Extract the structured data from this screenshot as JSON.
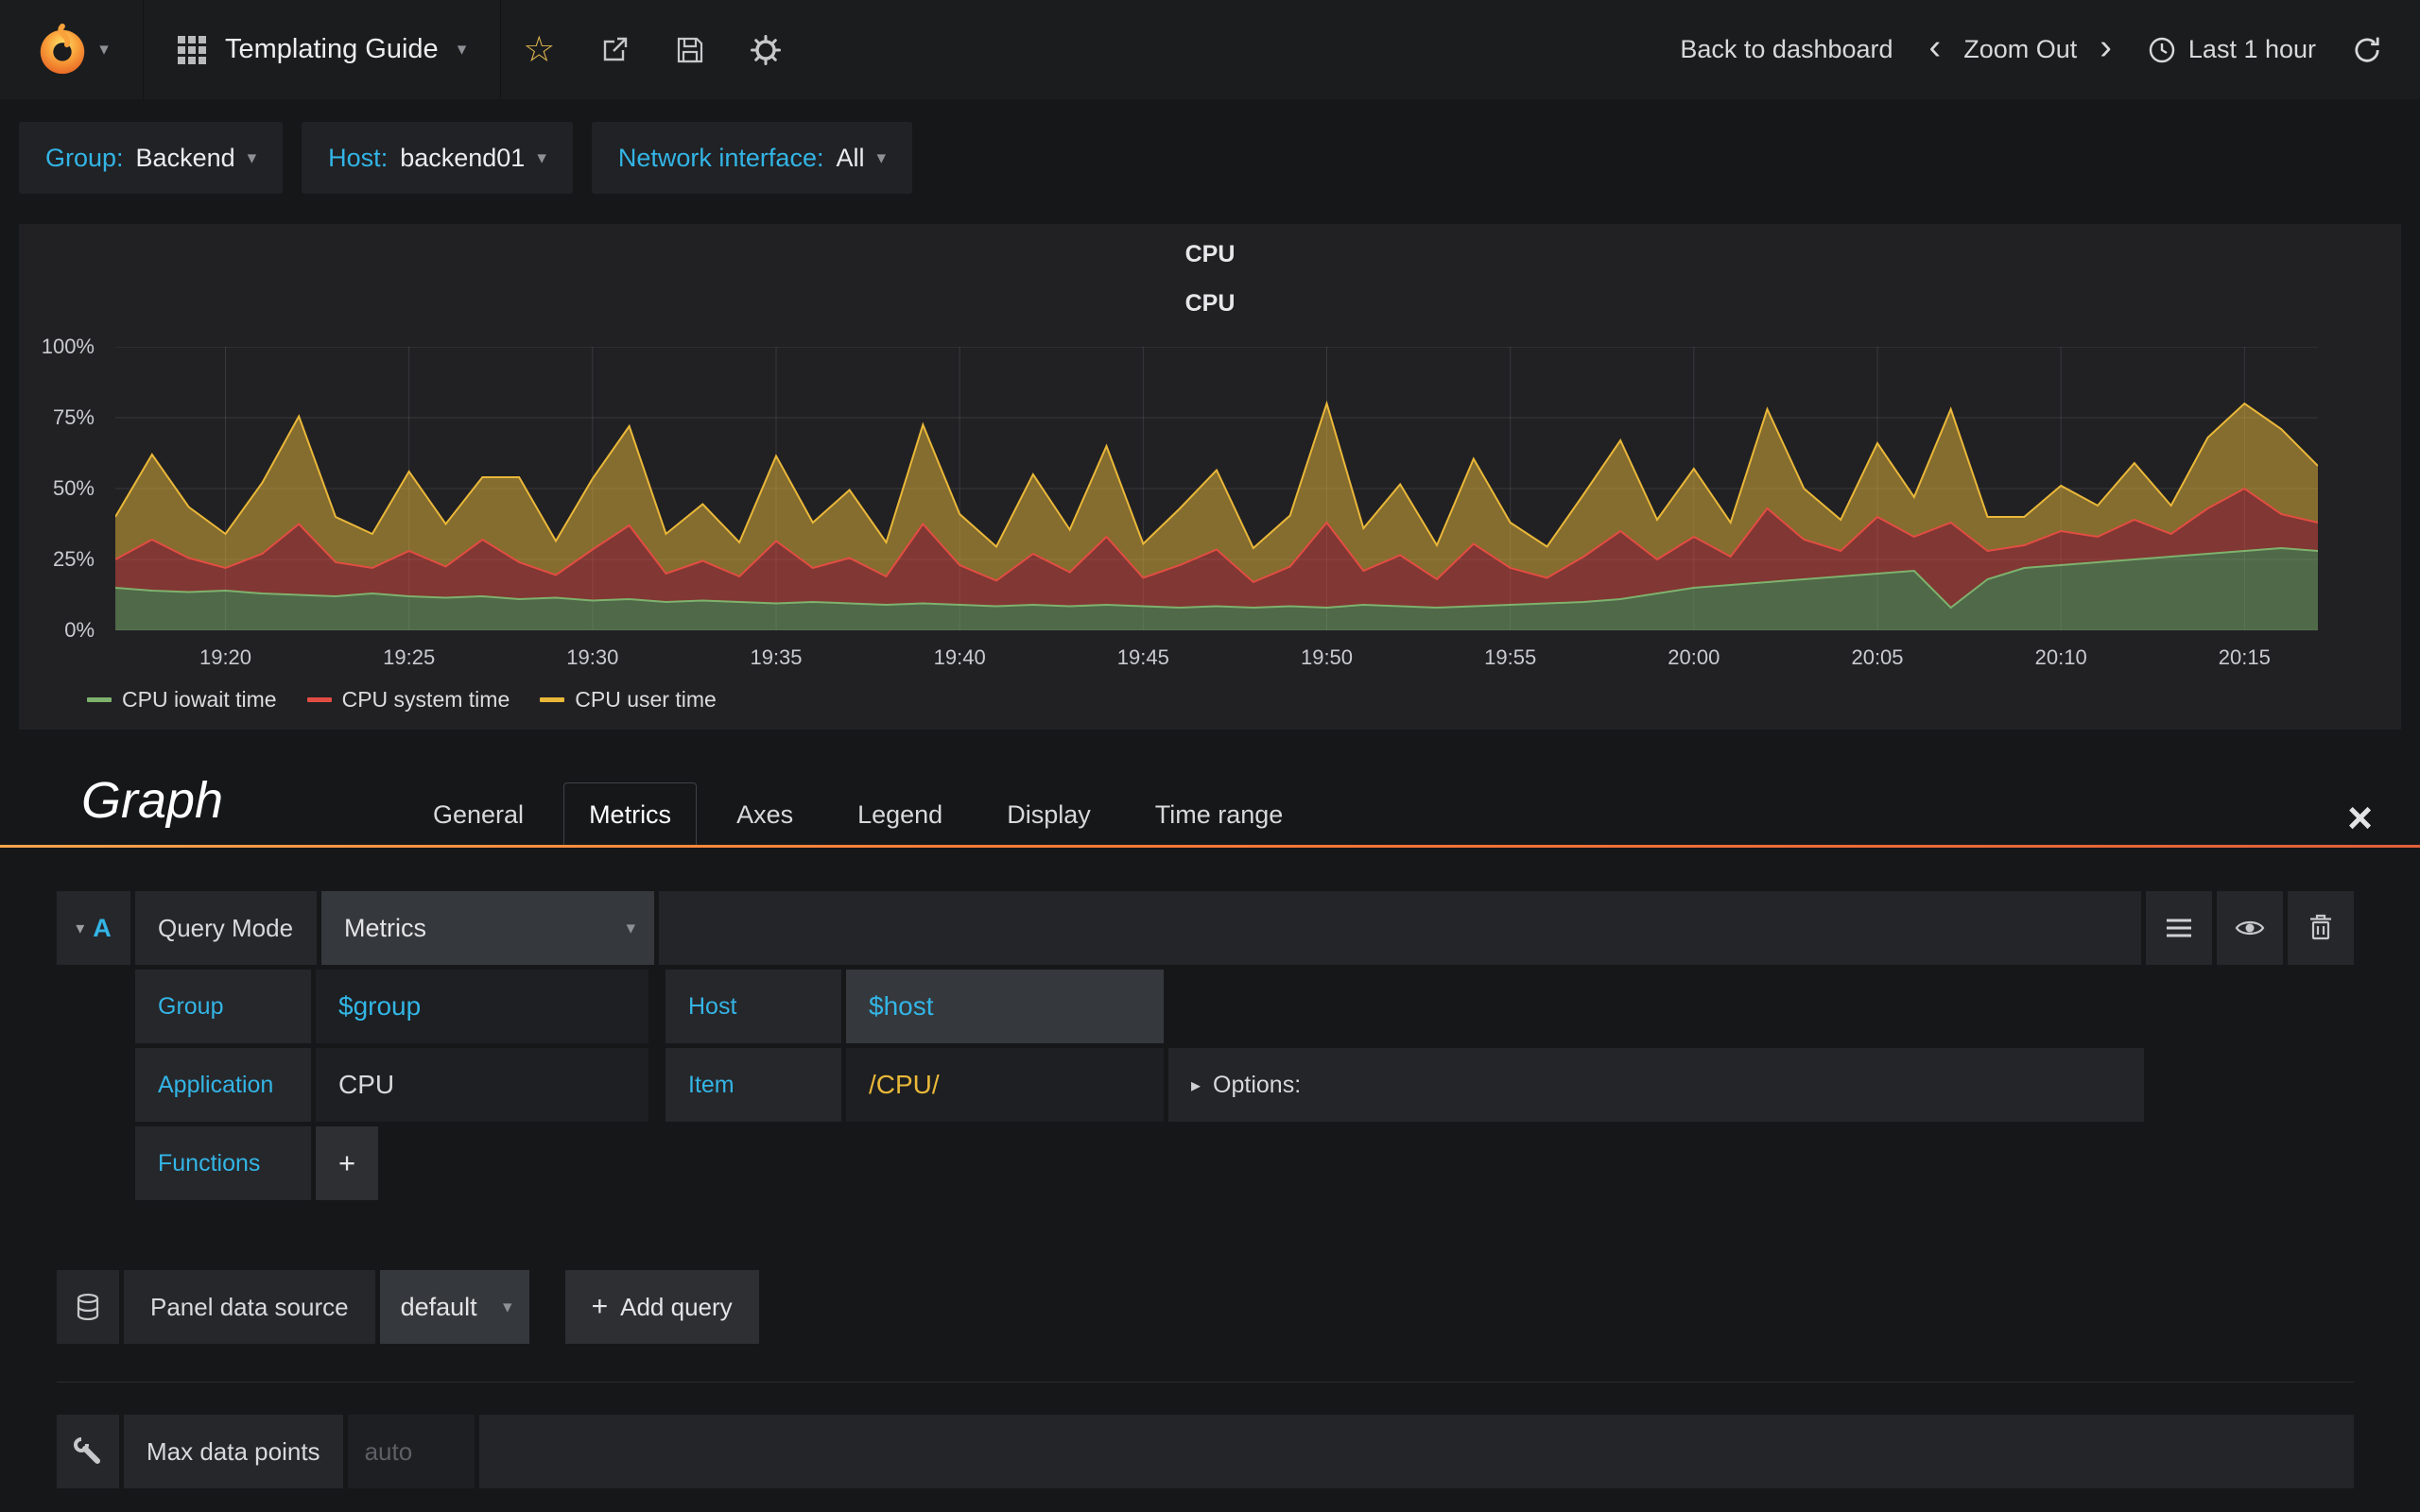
{
  "navbar": {
    "dashboard_title": "Templating Guide",
    "back_to_dashboard": "Back to dashboard",
    "zoom_out": "Zoom Out",
    "time_range": "Last 1 hour"
  },
  "icons": {
    "caret_down": "▾",
    "collapse_caret": "▾",
    "options_caret": "▸",
    "close": "×",
    "star": "☆",
    "plus": "+",
    "chevron_left": "‹",
    "chevron_right": "›"
  },
  "variables": [
    {
      "label": "Group:",
      "value": "Backend"
    },
    {
      "label": "Host:",
      "value": "backend01"
    },
    {
      "label": "Network interface:",
      "value": "All"
    }
  ],
  "panel": {
    "title": "CPU"
  },
  "chart_data": {
    "type": "area",
    "stacked": true,
    "title": "CPU",
    "xlabel": "",
    "ylabel": "",
    "ylim": [
      0,
      100
    ],
    "x_start": "19:17",
    "x_end": "20:17",
    "grid": true,
    "legend_position": "bottom-left",
    "y_ticks": [
      {
        "label": "100%",
        "value": 100
      },
      {
        "label": "75%",
        "value": 75
      },
      {
        "label": "50%",
        "value": 50
      },
      {
        "label": "25%",
        "value": 25
      },
      {
        "label": "0%",
        "value": 0
      }
    ],
    "x_ticks": [
      {
        "label": "19:20",
        "index": 3
      },
      {
        "label": "19:25",
        "index": 8
      },
      {
        "label": "19:30",
        "index": 13
      },
      {
        "label": "19:35",
        "index": 18
      },
      {
        "label": "19:40",
        "index": 23
      },
      {
        "label": "19:45",
        "index": 28
      },
      {
        "label": "19:50",
        "index": 33
      },
      {
        "label": "19:55",
        "index": 38
      },
      {
        "label": "20:00",
        "index": 43
      },
      {
        "label": "20:05",
        "index": 48
      },
      {
        "label": "20:10",
        "index": 53
      },
      {
        "label": "20:15",
        "index": 58
      }
    ],
    "series": [
      {
        "name": "CPU iowait time",
        "color": "#7EB26D",
        "values": [
          15,
          14,
          13.5,
          14,
          13,
          12.5,
          12,
          13,
          12,
          11.5,
          12,
          11,
          11.5,
          10.5,
          11,
          10,
          10.5,
          10,
          9.5,
          10,
          9.5,
          9,
          9.5,
          9,
          8.5,
          9,
          8.5,
          9,
          8.5,
          8,
          8.5,
          8,
          8.5,
          8,
          9,
          8.5,
          8,
          8.5,
          9,
          9.5,
          10,
          11,
          13,
          15,
          16,
          17,
          18,
          19,
          20,
          21,
          8,
          18,
          22,
          23,
          24,
          25,
          26,
          27,
          28,
          29,
          28
        ]
      },
      {
        "name": "CPU system time",
        "color": "#E24D42",
        "values": [
          10,
          18,
          12,
          8,
          14,
          25,
          12,
          9,
          16,
          11,
          20,
          13,
          8,
          18,
          26,
          10,
          14,
          9,
          22,
          12,
          16,
          10,
          28,
          14,
          9,
          18,
          12,
          24,
          10,
          15,
          20,
          9,
          14,
          30,
          12,
          18,
          10,
          22,
          13,
          9,
          16,
          24,
          12,
          18,
          10,
          26,
          14,
          9,
          20,
          12,
          30,
          10,
          8,
          12,
          9,
          14,
          8,
          16,
          22,
          12,
          10
        ]
      },
      {
        "name": "CPU user time",
        "color": "#EAB839",
        "values": [
          15,
          30,
          18,
          12,
          25,
          38,
          16,
          12,
          28,
          15,
          22,
          30,
          12,
          25,
          35,
          14,
          20,
          12,
          30,
          16,
          24,
          12,
          35,
          18,
          12,
          28,
          15,
          32,
          12,
          20,
          28,
          12,
          18,
          42,
          15,
          25,
          12,
          30,
          16,
          11,
          22,
          32,
          14,
          24,
          12,
          35,
          18,
          11,
          26,
          14,
          40,
          12,
          10,
          16,
          11,
          20,
          10,
          25,
          30,
          30,
          20
        ]
      }
    ]
  },
  "editor": {
    "panel_type": "Graph",
    "tabs": [
      "General",
      "Metrics",
      "Axes",
      "Legend",
      "Display",
      "Time range"
    ],
    "active_tab": "Metrics",
    "query": {
      "ref_id": "A",
      "query_mode_label": "Query Mode",
      "query_mode_value": "Metrics",
      "group_label": "Group",
      "group_value": "$group",
      "host_label": "Host",
      "host_value": "$host",
      "application_label": "Application",
      "application_value": "CPU",
      "item_label": "Item",
      "item_value": "/CPU/",
      "options_label": "Options:",
      "functions_label": "Functions"
    },
    "datasource": {
      "label": "Panel data source",
      "value": "default",
      "add_query_label": "Add query"
    },
    "max_data_points": {
      "label": "Max data points",
      "placeholder": "auto"
    }
  }
}
